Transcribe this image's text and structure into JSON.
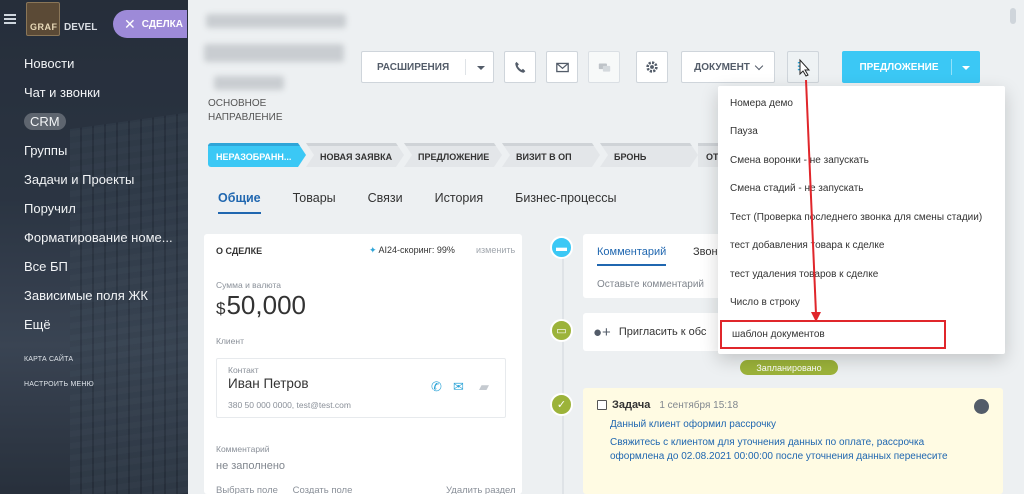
{
  "sidebar": {
    "logo_text": "GRAF",
    "logo_text_right": "DEVEL",
    "items": [
      {
        "label": "Новости"
      },
      {
        "label": "Чат и звонки"
      },
      {
        "label": "CRM",
        "active": true
      },
      {
        "label": "Группы"
      },
      {
        "label": "Задачи и Проекты"
      },
      {
        "label": "Поручил"
      },
      {
        "label": "Форматирование номе..."
      },
      {
        "label": "Все БП"
      },
      {
        "label": "Зависимые поля ЖК"
      },
      {
        "label": "Ещё"
      }
    ],
    "small_links": [
      "Карта сайта",
      "Настроить меню"
    ],
    "deal_badge": "СДЕЛКА"
  },
  "header": {
    "direction_label": "ОСНОВНОЕ НАПРАВЛЕНИЕ"
  },
  "toolbar": {
    "extensions": "РАСШИРЕНИЯ",
    "document": "ДОКУМЕНТ",
    "offer": "ПРЕДЛОЖЕНИЕ",
    "icons": [
      "phone-icon",
      "mail-icon",
      "chat-icon",
      "gear-icon",
      "script-icon"
    ]
  },
  "stages": [
    "НЕРАЗОБРАНН...",
    "НОВАЯ ЗАЯВКА",
    "ПРЕДЛОЖЕНИЕ",
    "ВИЗИТ В ОП",
    "БРОНЬ",
    "ОТ"
  ],
  "tabs": [
    "Общие",
    "Товары",
    "Связи",
    "История",
    "Бизнес-процессы"
  ],
  "deal_card": {
    "title": "О СДЕЛКЕ",
    "scoring": "AI24-скоринг: 99%",
    "edit": "изменить",
    "amount_label": "Сумма и валюта",
    "currency": "$",
    "amount": "50,000",
    "client_label": "Клиент",
    "contact_label": "Контакт",
    "contact_name": "Иван Петров",
    "contact_info": "380 50 000 0000, test@test.com",
    "comment_label": "Комментарий",
    "comment_value": "не заполнено",
    "bottom_links": [
      "Выбрать поле",
      "Создать поле",
      "Удалить раздел"
    ]
  },
  "timeline": {
    "tabs": [
      "Комментарий",
      "Звон"
    ],
    "comment_placeholder": "Оставьте комментарий",
    "invite_text": "Пригласить к обс",
    "planned_badge": "Запланировано",
    "task": {
      "title": "Задача",
      "date": "1 сентября 15:18",
      "subtitle": "Данный клиент оформил рассрочку",
      "description": "Свяжитесь с клиентом для уточнения данных по оплате, рассрочка оформлена до 02.08.2021 00:00:00 после уточнения данных перенесите"
    }
  },
  "dropdown": {
    "items": [
      "Номера демо",
      "Пауза",
      "Смена воронки - не запускать",
      "Смена стадий - не запускать",
      "Тест (Проверка последнего звонка для смены стадии)",
      "тест добавления товара к сделке",
      "тест удаления товаров к сделке",
      "Число в строку",
      "шаблон документов"
    ],
    "highlighted_index": 8
  },
  "colors": {
    "accent": "#3bc8f5",
    "link": "#2067b0",
    "annotation": "#e0262b",
    "planned": "#9cb33a"
  }
}
